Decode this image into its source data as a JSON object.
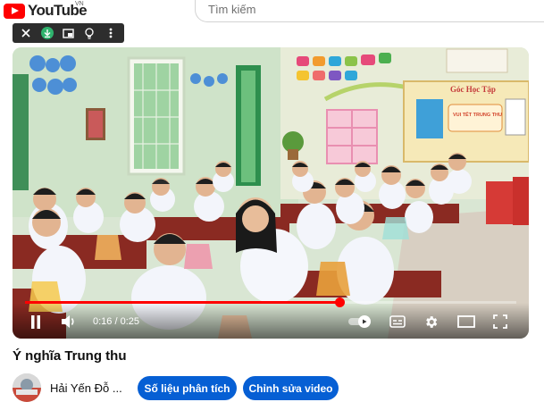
{
  "header": {
    "logo_text": "YouTube",
    "country": "VN",
    "search_placeholder": "Tìm kiếm"
  },
  "minibar": {
    "icons": [
      "close-icon",
      "download-icon",
      "picture-in-picture-icon",
      "lightbulb-icon",
      "more-icon"
    ]
  },
  "video": {
    "board_heading": "Góc Học Tập",
    "board_tag": "VUI TẾT TRUNG THU",
    "time_current": "0:16",
    "time_total": "0:25",
    "time_separator": " / ",
    "progress": 0.64,
    "colors": {
      "progress": "#ff0000"
    }
  },
  "info": {
    "title": "Ý nghĩa Trung thu",
    "channel": "Hải Yến Đỗ ...",
    "analytics_button": "Số liệu phân tích",
    "edit_button": "Chỉnh sửa video",
    "button_color": "#065fd4"
  }
}
